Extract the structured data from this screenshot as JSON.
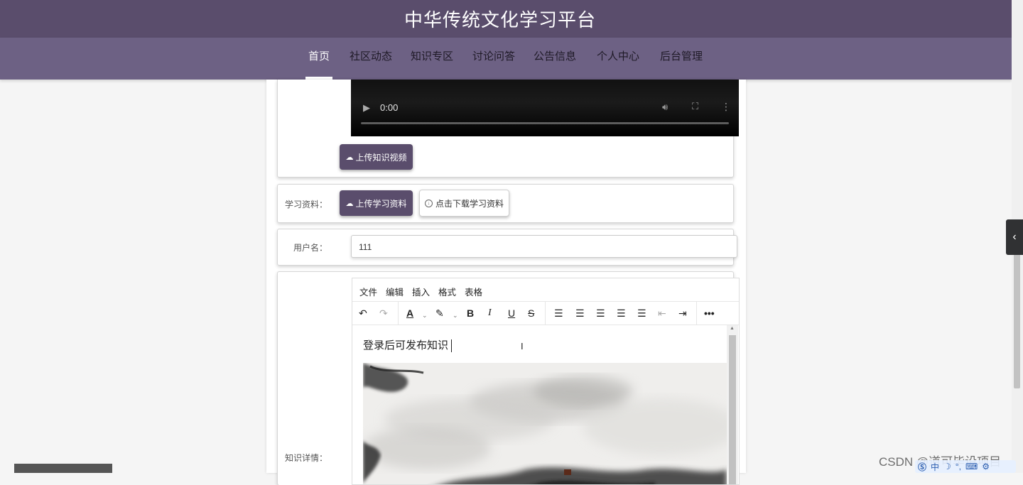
{
  "header": {
    "site_title": "中华传统文化学习平台",
    "nav": [
      {
        "label": "首页",
        "active": true
      },
      {
        "label": "社区动态"
      },
      {
        "label": "知识专区"
      },
      {
        "label": "讨论问答"
      },
      {
        "label": "公告信息"
      },
      {
        "label": "个人中心"
      },
      {
        "label": "后台管理"
      }
    ]
  },
  "video": {
    "time": "0:00"
  },
  "upload_video_label": "上传知识视频",
  "study_material": {
    "label": "学习资料：",
    "upload_label": "上传学习资料",
    "download_label": "点击下载学习资料"
  },
  "username": {
    "label": "用户名：",
    "value": "111"
  },
  "editor": {
    "label": "知识详情：",
    "menus": [
      "文件",
      "编辑",
      "插入",
      "格式",
      "表格"
    ],
    "content_text": "登录后可发布知识"
  },
  "watermark": "CSDN @道可毕设项目",
  "ime": "中"
}
